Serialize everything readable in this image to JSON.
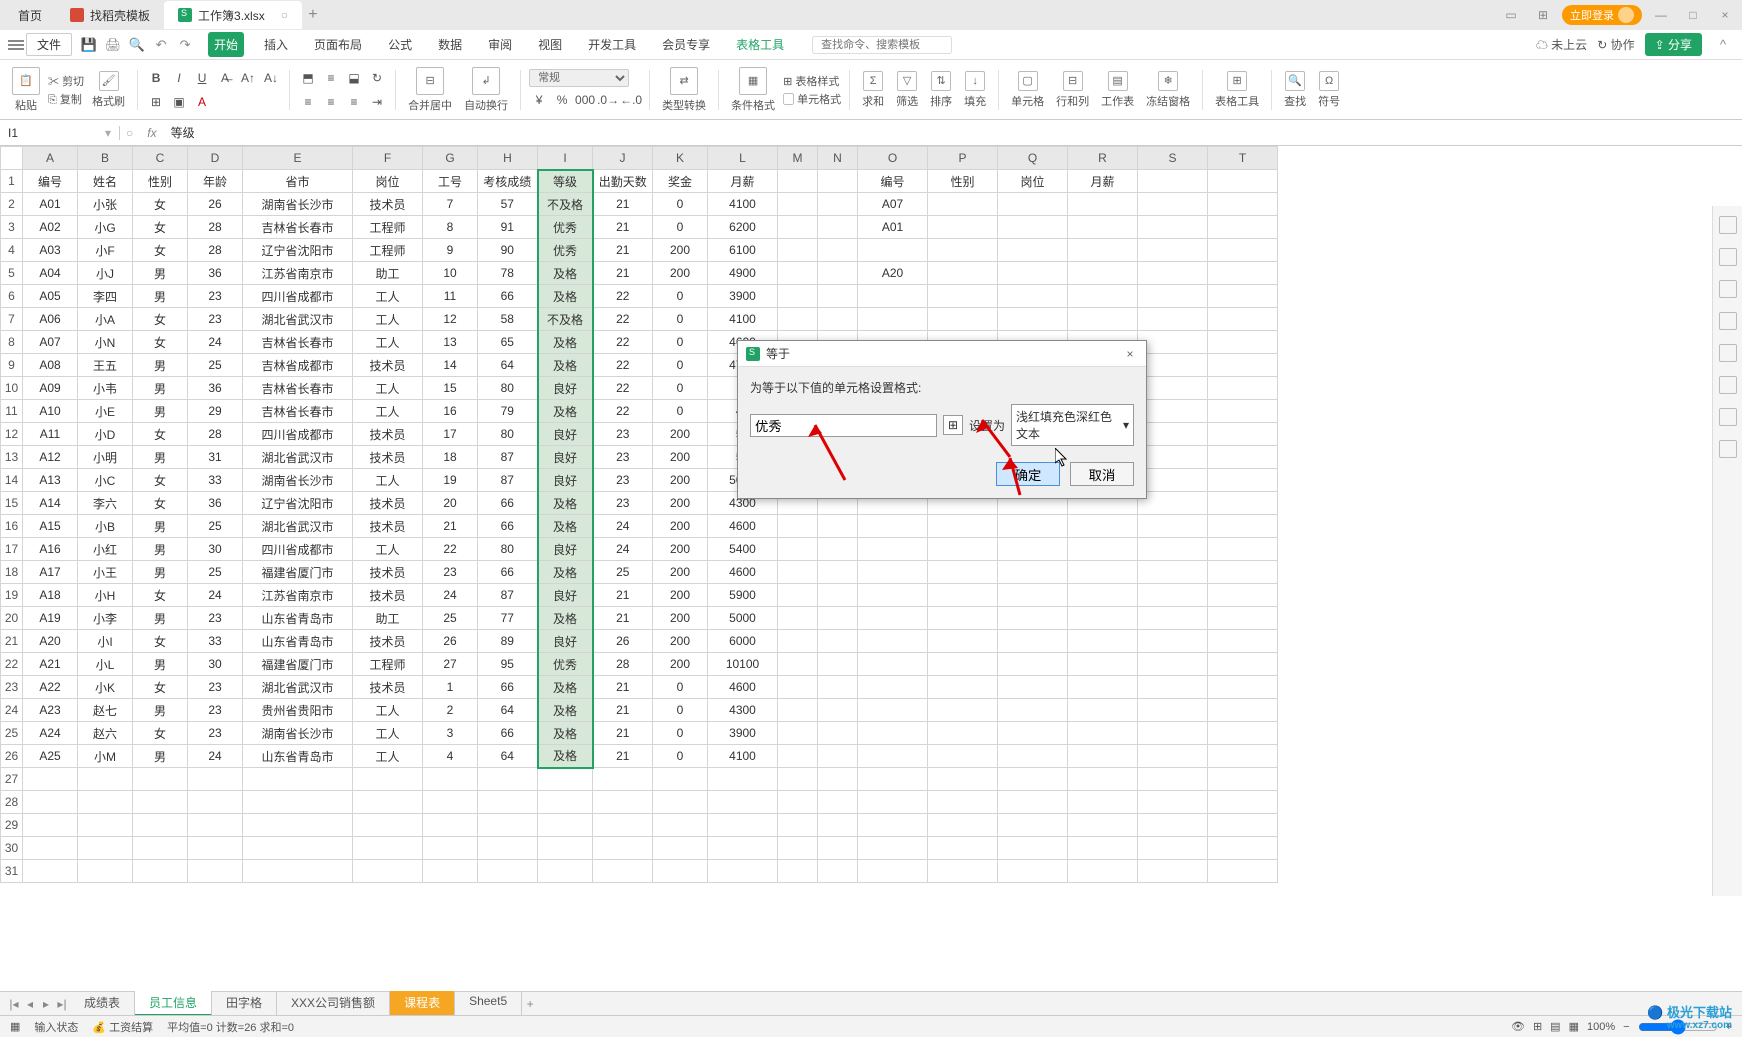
{
  "titlebar": {
    "home": "首页",
    "template_tab": "找稻壳模板",
    "doc_tab": "工作簿3.xlsx",
    "login": "立即登录"
  },
  "menubar": {
    "file": "文件",
    "tabs": [
      "开始",
      "插入",
      "页面布局",
      "公式",
      "数据",
      "审阅",
      "视图",
      "开发工具",
      "会员专享",
      "表格工具"
    ],
    "search_placeholder": "查找命令、搜索模板",
    "cloud": "未上云",
    "coop": "协作",
    "share": "分享"
  },
  "ribbon": {
    "paste": "粘贴",
    "cut": "剪切",
    "copy": "复制",
    "fmtpaint": "格式刷",
    "merge": "合并居中",
    "wrap": "自动换行",
    "numfmt": "常规",
    "typeconv": "类型转换",
    "condfmt": "条件格式",
    "cellfmt": "表格样式",
    "cellstyle": "单元格式",
    "sum": "求和",
    "filter": "筛选",
    "sort": "排序",
    "fill": "填充",
    "cell": "单元格",
    "rowcol": "行和列",
    "sheet": "工作表",
    "freeze": "冻结窗格",
    "tools": "表格工具",
    "find": "查找",
    "symbol": "符号"
  },
  "fx": {
    "cell": "I1",
    "value": "等级"
  },
  "columns": [
    "A",
    "B",
    "C",
    "D",
    "E",
    "F",
    "G",
    "H",
    "I",
    "J",
    "K",
    "L",
    "M",
    "N",
    "O",
    "P",
    "Q",
    "R",
    "S",
    "T"
  ],
  "headers": [
    "编号",
    "姓名",
    "性别",
    "年龄",
    "省市",
    "岗位",
    "工号",
    "考核成绩",
    "等级",
    "出勤天数",
    "奖金",
    "月薪",
    "",
    "",
    "编号",
    "性别",
    "岗位",
    "月薪",
    "",
    ""
  ],
  "rows": [
    [
      "A01",
      "小张",
      "女",
      "26",
      "湖南省长沙市",
      "技术员",
      "7",
      "57",
      "不及格",
      "21",
      "0",
      "4100",
      "",
      "",
      "A07",
      "",
      "",
      "",
      "",
      ""
    ],
    [
      "A02",
      "小G",
      "女",
      "28",
      "吉林省长春市",
      "工程师",
      "8",
      "91",
      "优秀",
      "21",
      "0",
      "6200",
      "",
      "",
      "A01",
      "",
      "",
      "",
      "",
      ""
    ],
    [
      "A03",
      "小F",
      "女",
      "28",
      "辽宁省沈阳市",
      "工程师",
      "9",
      "90",
      "优秀",
      "21",
      "200",
      "6100",
      "",
      "",
      "",
      "",
      "",
      "",
      "",
      ""
    ],
    [
      "A04",
      "小J",
      "男",
      "36",
      "江苏省南京市",
      "助工",
      "10",
      "78",
      "及格",
      "21",
      "200",
      "4900",
      "",
      "",
      "A20",
      "",
      "",
      "",
      "",
      ""
    ],
    [
      "A05",
      "李四",
      "男",
      "23",
      "四川省成都市",
      "工人",
      "11",
      "66",
      "及格",
      "22",
      "0",
      "3900",
      "",
      "",
      "",
      "",
      "",
      "",
      "",
      ""
    ],
    [
      "A06",
      "小A",
      "女",
      "23",
      "湖北省武汉市",
      "工人",
      "12",
      "58",
      "不及格",
      "22",
      "0",
      "4100",
      "",
      "",
      "",
      "",
      "",
      "",
      "",
      ""
    ],
    [
      "A07",
      "小N",
      "女",
      "24",
      "吉林省长春市",
      "工人",
      "13",
      "65",
      "及格",
      "22",
      "0",
      "4600",
      "",
      "",
      "",
      "",
      "",
      "",
      "",
      ""
    ],
    [
      "A08",
      "王五",
      "男",
      "25",
      "吉林省成都市",
      "技术员",
      "14",
      "64",
      "及格",
      "22",
      "0",
      "4700",
      "",
      "",
      "",
      "",
      "",
      "",
      "",
      ""
    ],
    [
      "A09",
      "小韦",
      "男",
      "36",
      "吉林省长春市",
      "工人",
      "15",
      "80",
      "良好",
      "22",
      "0",
      "",
      "",
      "",
      "",
      "",
      "",
      "",
      "",
      ""
    ],
    [
      "A10",
      "小E",
      "男",
      "29",
      "吉林省长春市",
      "工人",
      "16",
      "79",
      "及格",
      "22",
      "0",
      "44",
      "",
      "",
      "",
      "",
      "",
      "",
      "",
      ""
    ],
    [
      "A11",
      "小D",
      "女",
      "28",
      "四川省成都市",
      "技术员",
      "17",
      "80",
      "良好",
      "23",
      "200",
      "51",
      "",
      "",
      "",
      "",
      "",
      "",
      "",
      ""
    ],
    [
      "A12",
      "小明",
      "男",
      "31",
      "湖北省武汉市",
      "技术员",
      "18",
      "87",
      "良好",
      "23",
      "200",
      "53",
      "",
      "",
      "",
      "",
      "",
      "",
      "",
      ""
    ],
    [
      "A13",
      "小C",
      "女",
      "33",
      "湖南省长沙市",
      "工人",
      "19",
      "87",
      "良好",
      "23",
      "200",
      "5000",
      "",
      "",
      "",
      "",
      "",
      "",
      "",
      ""
    ],
    [
      "A14",
      "李六",
      "女",
      "36",
      "辽宁省沈阳市",
      "技术员",
      "20",
      "66",
      "及格",
      "23",
      "200",
      "4300",
      "",
      "",
      "",
      "",
      "",
      "",
      "",
      ""
    ],
    [
      "A15",
      "小B",
      "男",
      "25",
      "湖北省武汉市",
      "技术员",
      "21",
      "66",
      "及格",
      "24",
      "200",
      "4600",
      "",
      "",
      "",
      "",
      "",
      "",
      "",
      ""
    ],
    [
      "A16",
      "小红",
      "男",
      "30",
      "四川省成都市",
      "工人",
      "22",
      "80",
      "良好",
      "24",
      "200",
      "5400",
      "",
      "",
      "",
      "",
      "",
      "",
      "",
      ""
    ],
    [
      "A17",
      "小王",
      "男",
      "25",
      "福建省厦门市",
      "技术员",
      "23",
      "66",
      "及格",
      "25",
      "200",
      "4600",
      "",
      "",
      "",
      "",
      "",
      "",
      "",
      ""
    ],
    [
      "A18",
      "小H",
      "女",
      "24",
      "江苏省南京市",
      "技术员",
      "24",
      "87",
      "良好",
      "21",
      "200",
      "5900",
      "",
      "",
      "",
      "",
      "",
      "",
      "",
      ""
    ],
    [
      "A19",
      "小李",
      "男",
      "23",
      "山东省青岛市",
      "助工",
      "25",
      "77",
      "及格",
      "21",
      "200",
      "5000",
      "",
      "",
      "",
      "",
      "",
      "",
      "",
      ""
    ],
    [
      "A20",
      "小I",
      "女",
      "33",
      "山东省青岛市",
      "技术员",
      "26",
      "89",
      "良好",
      "26",
      "200",
      "6000",
      "",
      "",
      "",
      "",
      "",
      "",
      "",
      ""
    ],
    [
      "A21",
      "小L",
      "男",
      "30",
      "福建省厦门市",
      "工程师",
      "27",
      "95",
      "优秀",
      "28",
      "200",
      "10100",
      "",
      "",
      "",
      "",
      "",
      "",
      "",
      ""
    ],
    [
      "A22",
      "小K",
      "女",
      "23",
      "湖北省武汉市",
      "技术员",
      "1",
      "66",
      "及格",
      "21",
      "0",
      "4600",
      "",
      "",
      "",
      "",
      "",
      "",
      "",
      ""
    ],
    [
      "A23",
      "赵七",
      "男",
      "23",
      "贵州省贵阳市",
      "工人",
      "2",
      "64",
      "及格",
      "21",
      "0",
      "4300",
      "",
      "",
      "",
      "",
      "",
      "",
      "",
      ""
    ],
    [
      "A24",
      "赵六",
      "女",
      "23",
      "湖南省长沙市",
      "工人",
      "3",
      "66",
      "及格",
      "21",
      "0",
      "3900",
      "",
      "",
      "",
      "",
      "",
      "",
      "",
      ""
    ],
    [
      "A25",
      "小M",
      "男",
      "24",
      "山东省青岛市",
      "工人",
      "4",
      "64",
      "及格",
      "21",
      "0",
      "4100",
      "",
      "",
      "",
      "",
      "",
      "",
      "",
      ""
    ]
  ],
  "sheets": {
    "tabs": [
      "成绩表",
      "员工信息",
      "田字格",
      "XXX公司销售额",
      "课程表",
      "Sheet5"
    ],
    "active": 1,
    "orange": 4
  },
  "dialog": {
    "title": "等于",
    "prompt": "为等于以下值的单元格设置格式:",
    "value": "优秀",
    "setas": "设置为",
    "format": "浅红填充色深红色文本",
    "ok": "确定",
    "cancel": "取消"
  },
  "status": {
    "mode": "输入状态",
    "calc": "工资结算",
    "avg": "平均值=0  计数=26  求和=0",
    "zoom": "100%"
  },
  "watermark": {
    "main": "极光下载站",
    "sub": "www.xz7.com"
  }
}
